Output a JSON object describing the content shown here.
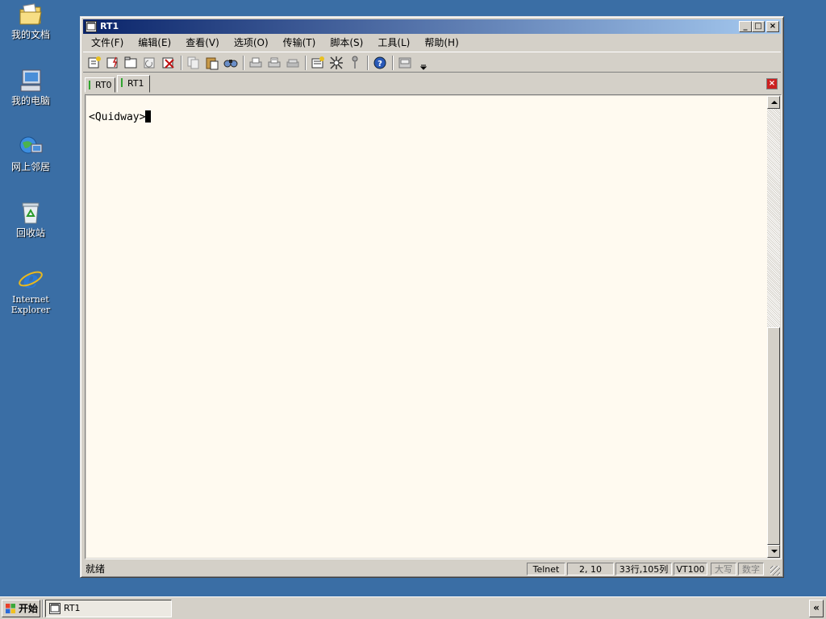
{
  "desktop": {
    "icons": [
      {
        "label": "我的文档",
        "icon": "my-documents-icon"
      },
      {
        "label": "我的电脑",
        "icon": "my-computer-icon"
      },
      {
        "label": "网上邻居",
        "icon": "network-places-icon"
      },
      {
        "label": "回收站",
        "icon": "recycle-bin-icon"
      },
      {
        "label": "Internet\nExplorer",
        "icon": "internet-explorer-icon"
      }
    ],
    "background_color": "#3a6ea5"
  },
  "window": {
    "title": "RT1",
    "controls": {
      "minimize": "_",
      "maximize": "□",
      "close": "×"
    }
  },
  "menu": [
    {
      "label": "文件(F)"
    },
    {
      "label": "编辑(E)"
    },
    {
      "label": "查看(V)"
    },
    {
      "label": "选项(O)"
    },
    {
      "label": "传输(T)"
    },
    {
      "label": "脚本(S)"
    },
    {
      "label": "工具(L)"
    },
    {
      "label": "帮助(H)"
    }
  ],
  "toolbar": {
    "icons": [
      "connect-icon",
      "quick-connect-icon",
      "connect-in-tab-icon",
      "reconnect-icon",
      "disconnect-icon",
      "copy-icon",
      "paste-icon",
      "find-icon",
      "print-icon",
      "print-selection-icon",
      "print-setup-icon",
      "session-options-icon",
      "global-options-icon",
      "keymap-icon",
      "help-icon",
      "sftp-icon",
      "toolbar-dropdown-icon"
    ]
  },
  "tabs": [
    {
      "label": "RT0",
      "active": false
    },
    {
      "label": "RT1",
      "active": true
    }
  ],
  "terminal": {
    "prompt": "<Quidway>",
    "background": "#fffaf0"
  },
  "status": {
    "ready": "就绪",
    "protocol": "Telnet",
    "position": "2,  10",
    "size": "33行,105列",
    "emulation": "VT100",
    "caps": "大写",
    "num": "数字"
  },
  "taskbar": {
    "start_label": "开始",
    "task_label": "RT1",
    "tray_label": "«"
  }
}
